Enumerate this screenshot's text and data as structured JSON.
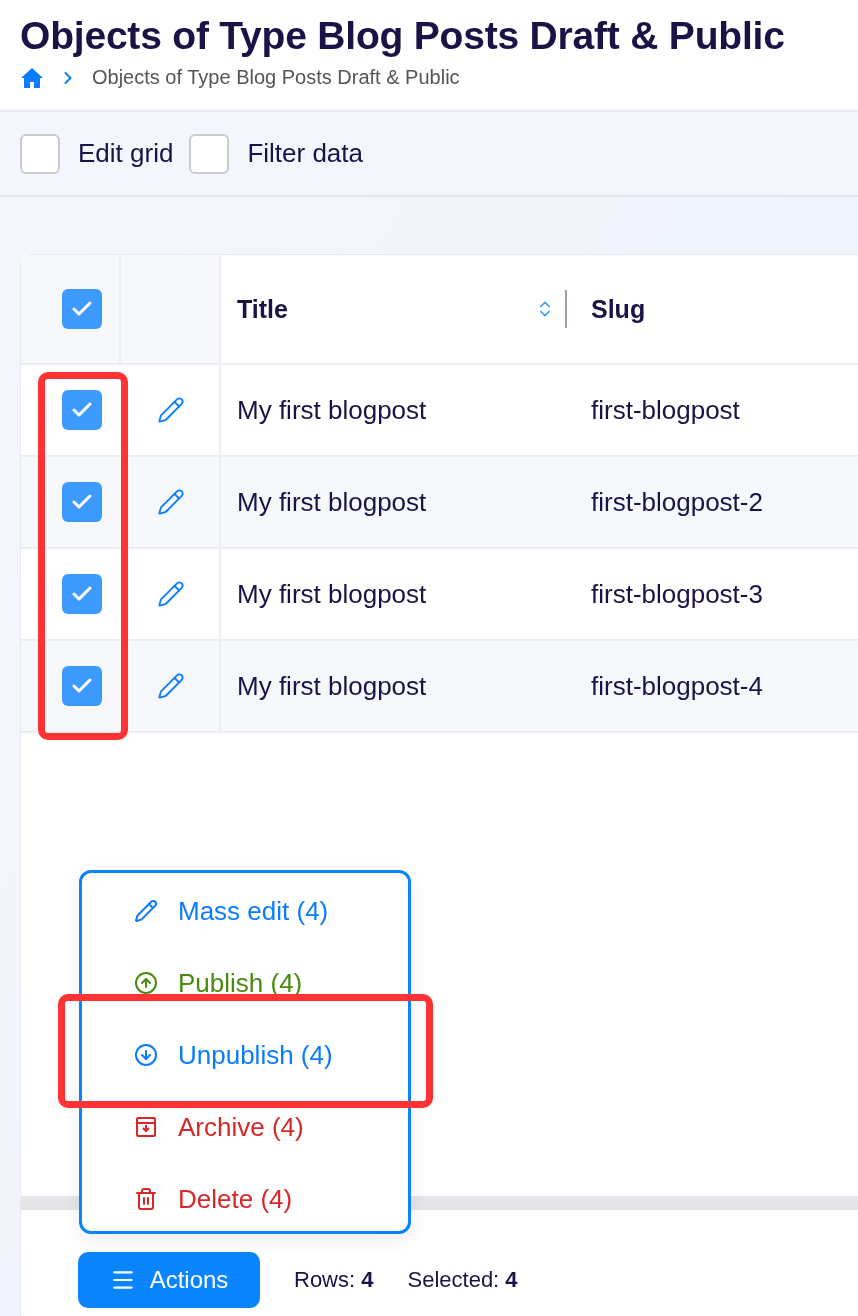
{
  "title": "Objects of Type Blog Posts Draft & Public",
  "breadcrumb": [
    "Objects of Type Blog Posts Draft & Public"
  ],
  "toolbar": [
    {
      "label": "Edit grid",
      "checked": false
    },
    {
      "label": "Filter data",
      "checked": false
    }
  ],
  "table": {
    "all_checked": true,
    "checkboxes_highlighted": true,
    "columns": [
      {
        "label": "Title",
        "sortable": true
      },
      {
        "label": "Slug",
        "sortable": false
      }
    ],
    "rows": [
      {
        "checked": true,
        "cells": [
          "My first blogpost",
          "first-blogpost"
        ]
      },
      {
        "checked": true,
        "cells": [
          "My first blogpost",
          "first-blogpost-2"
        ]
      },
      {
        "checked": true,
        "cells": [
          "My first blogpost",
          "first-blogpost-3"
        ]
      },
      {
        "checked": true,
        "cells": [
          "My first blogpost",
          "first-blogpost-4"
        ]
      }
    ]
  },
  "actions_menu": {
    "items": [
      {
        "kind": "edit",
        "label": "Mass edit (4)",
        "highlighted": false
      },
      {
        "kind": "publish",
        "label": "Publish (4)",
        "highlighted": false
      },
      {
        "kind": "unpublish",
        "label": "Unpublish (4)",
        "highlighted": true
      },
      {
        "kind": "archive",
        "label": "Archive (4)",
        "highlighted": false
      },
      {
        "kind": "delete",
        "label": "Delete (4)",
        "highlighted": false
      }
    ]
  },
  "footer": {
    "button": "Actions",
    "stats": [
      "Rows: **4**",
      "Selected: **4**"
    ]
  }
}
